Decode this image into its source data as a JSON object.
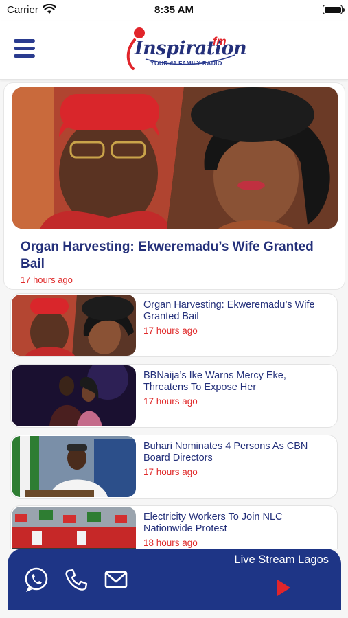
{
  "status_bar": {
    "carrier": "Carrier",
    "time": "8:35 AM"
  },
  "header": {
    "logo_text": "Inspiration",
    "logo_fm": "fm",
    "logo_tagline": "YOUR #1 FAMILY RADIO"
  },
  "featured": {
    "title": "Organ Harvesting: Ekweremadu’s Wife Granted Bail",
    "time": "17 hours ago"
  },
  "news": [
    {
      "title": "Organ Harvesting: Ekweremadu’s Wife Granted Bail",
      "time": "17 hours ago"
    },
    {
      "title": "BBNaija’s Ike Warns Mercy Eke, Threatens To Expose Her",
      "time": "17 hours ago"
    },
    {
      "title": "Buhari Nominates 4 Persons As CBN Board Directors",
      "time": "17 hours ago"
    },
    {
      "title": "Electricity Workers To Join NLC Nationwide Protest",
      "time": "18 hours ago"
    }
  ],
  "bottom_bar": {
    "live_label": "Live Stream Lagos",
    "icons": [
      "whatsapp-icon",
      "phone-icon",
      "mail-icon",
      "play-icon"
    ]
  },
  "colors": {
    "brand_blue": "#1e3586",
    "title_blue": "#24307a",
    "time_red": "#e02b2b",
    "accent_red": "#e1252b"
  }
}
